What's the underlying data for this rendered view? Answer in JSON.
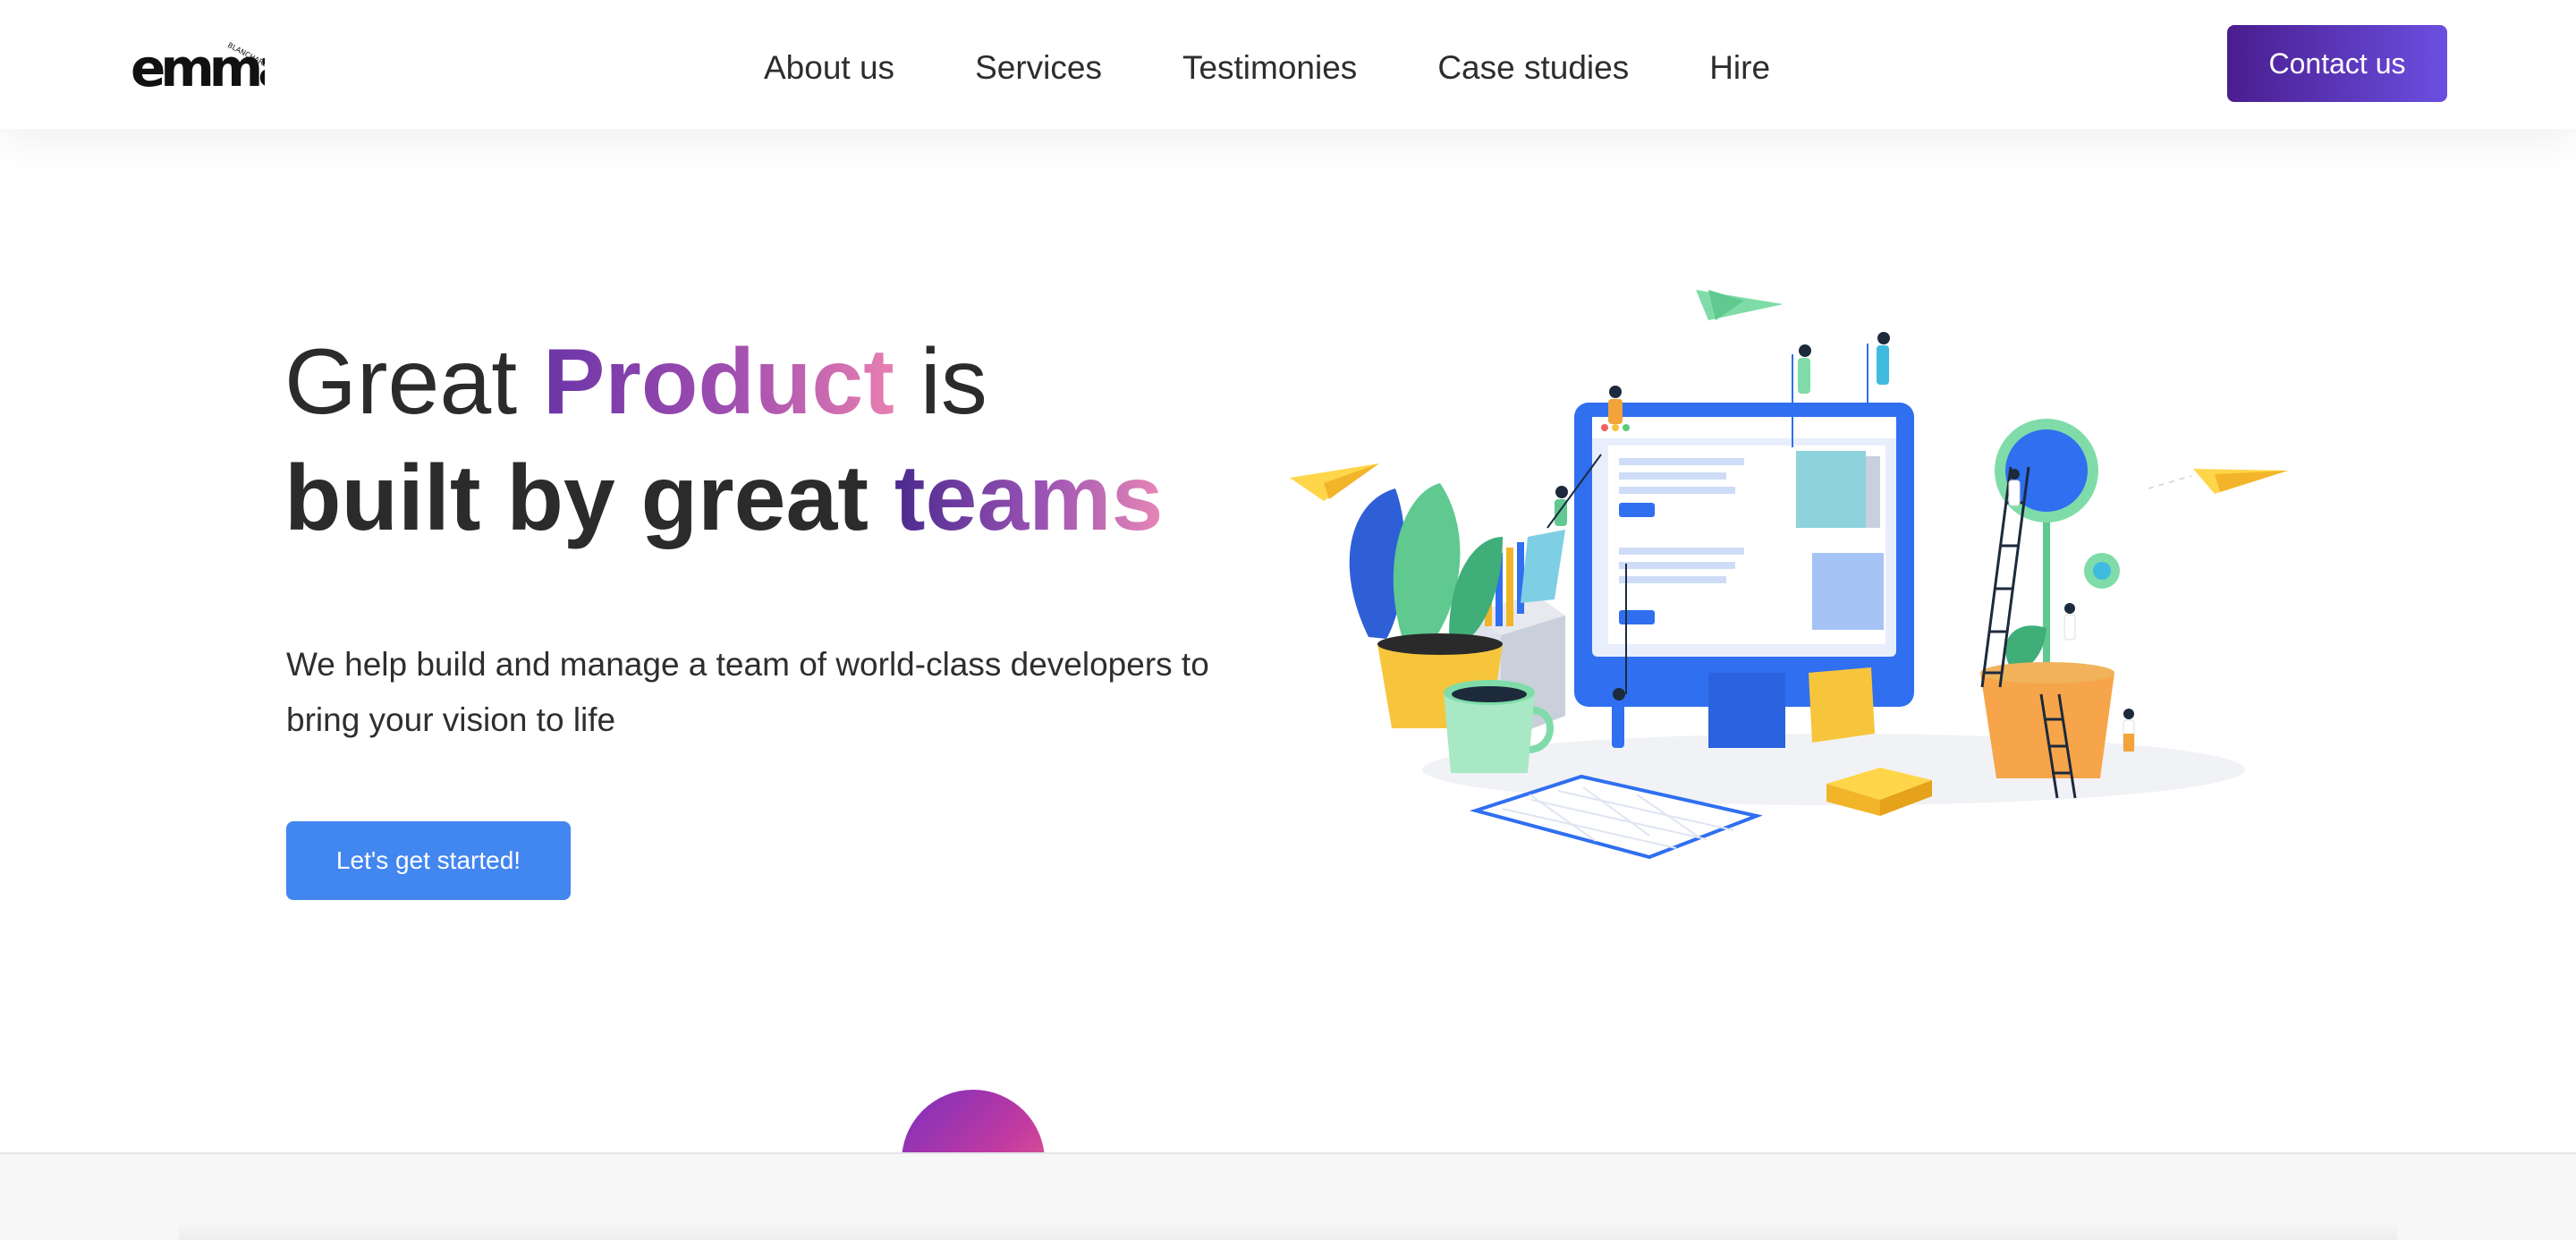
{
  "brand": {
    "logo_text": "emma",
    "logo_subtext": "BLANCHARD",
    "gradient_start": "#6c35a8",
    "gradient_end": "#e87fb1"
  },
  "nav": {
    "links": [
      {
        "label": "About us"
      },
      {
        "label": "Services"
      },
      {
        "label": "Testimonies"
      },
      {
        "label": "Case studies"
      },
      {
        "label": "Hire"
      }
    ],
    "contact_label": "Contact us",
    "contact_color": "#5533c0"
  },
  "hero": {
    "title_part1": "Great ",
    "title_highlight1": "Product",
    "title_part2": " is",
    "title_part3": "built by great ",
    "title_highlight2": "teams",
    "description": "We help build and manage a team of world-class developers to bring your vision to life",
    "cta_label": "Let's get started!",
    "cta_color": "#4286f0",
    "illustration": "team-building-computer-illustration"
  },
  "icons": [
    "logo-icon",
    "paper-plane-icon",
    "monitor-icon",
    "plant-icon",
    "ladder-icon",
    "coffee-cup-icon",
    "keyboard-icon"
  ]
}
